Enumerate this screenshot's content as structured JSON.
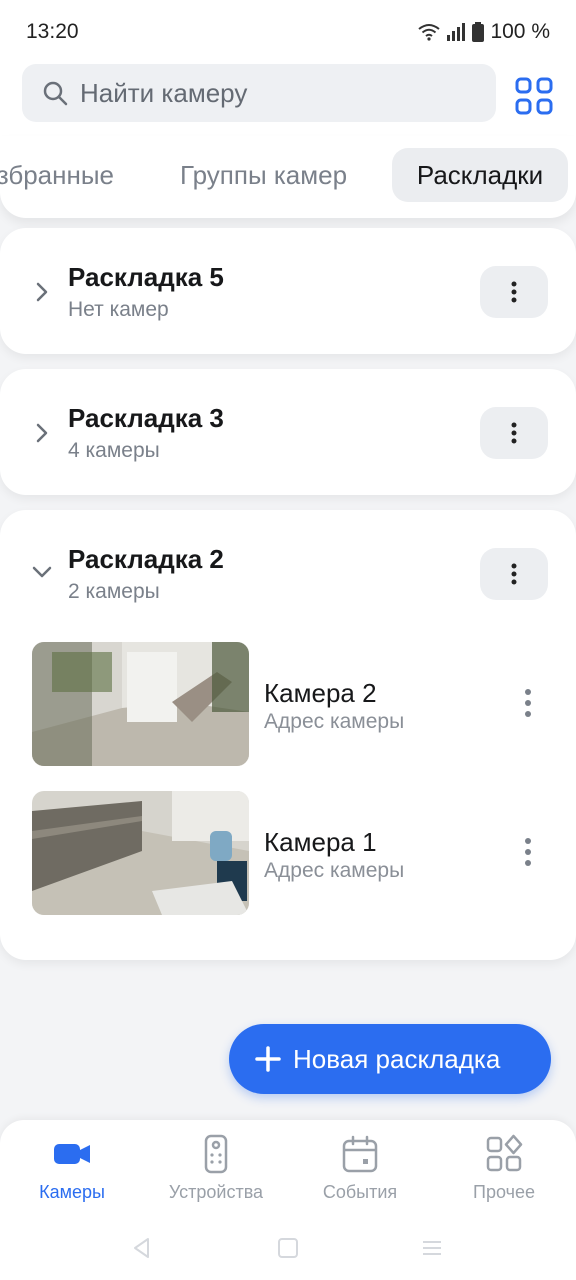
{
  "status": {
    "time": "13:20",
    "battery": "100 %"
  },
  "search": {
    "placeholder": "Найти камеру"
  },
  "tabs": {
    "favorites": "Избранные",
    "groups": "Группы камер",
    "layouts": "Раскладки"
  },
  "layouts": [
    {
      "title": "Раскладка 5",
      "subtitle": "Нет камер",
      "expanded": false
    },
    {
      "title": "Раскладка 3",
      "subtitle": "4 камеры",
      "expanded": false
    },
    {
      "title": "Раскладка 2",
      "subtitle": "2 камеры",
      "expanded": true,
      "cameras": [
        {
          "name": "Камера 2",
          "address": "Адрес камеры"
        },
        {
          "name": "Камера 1",
          "address": "Адрес камеры"
        }
      ]
    }
  ],
  "fab": {
    "label": "Новая раскладка"
  },
  "bottom_nav": [
    {
      "label": "Камеры",
      "icon": "camera-icon",
      "active": true
    },
    {
      "label": "Устройства",
      "icon": "remote-device-icon",
      "active": false
    },
    {
      "label": "События",
      "icon": "calendar-icon",
      "active": false
    },
    {
      "label": "Прочее",
      "icon": "more-apps-icon",
      "active": false
    }
  ],
  "colors": {
    "accent": "#2b6df0",
    "background": "#f3f4f6",
    "muted": "#7a808a"
  }
}
